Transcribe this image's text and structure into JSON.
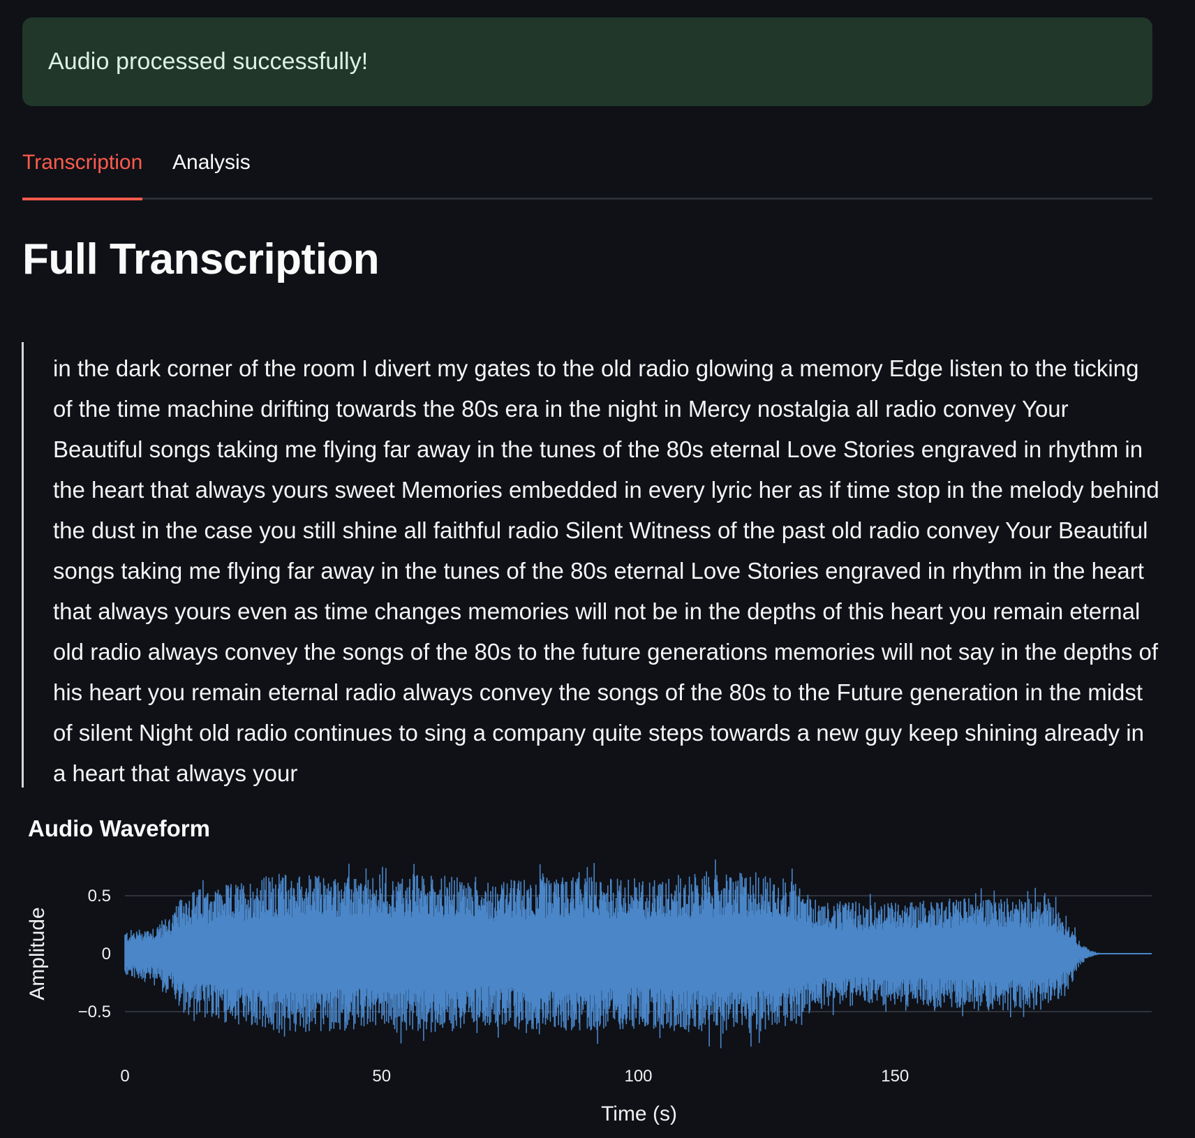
{
  "alert": {
    "message": "Audio processed successfully!",
    "color": "#203729"
  },
  "tabs": [
    {
      "label": "Transcription",
      "active": true
    },
    {
      "label": "Analysis",
      "active": false
    }
  ],
  "accent_color": "#ff5b4c",
  "heading": "Full Transcription",
  "transcription": "in the dark corner of the room I divert my gates to the old radio glowing a memory Edge listen to the ticking of the time machine drifting towards the 80s era in the night in Mercy nostalgia all radio convey Your Beautiful songs taking me flying far away in the tunes of the 80s eternal Love Stories engraved in rhythm in the heart that always yours sweet Memories embedded in every lyric her as if time stop in the melody behind the dust in the case you still shine all faithful radio Silent Witness of the past old radio convey Your Beautiful songs taking me flying far away in the tunes of the 80s eternal Love Stories engraved in rhythm in the heart that always yours even as time changes memories will not be in the depths of this heart you remain eternal old radio always convey the songs of the 80s to the future generations memories will not say in the depths of his heart you remain eternal radio always convey the songs of the 80s to the Future generation in the midst of silent Night old radio continues to sing a company quite steps towards a new guy keep shining already in a heart that always your",
  "waveform_title": "Audio Waveform",
  "chart_data": {
    "type": "area",
    "title": "Audio Waveform",
    "xlabel": "Time (s)",
    "ylabel": "Amplitude",
    "xlim": [
      0,
      200
    ],
    "ylim": [
      -0.85,
      0.85
    ],
    "x_ticks": [
      0,
      50,
      100,
      150
    ],
    "x_tick_labels": [
      "0",
      "50",
      "100",
      "150"
    ],
    "y_ticks": [
      0.5,
      0,
      -0.5
    ],
    "y_tick_labels": [
      "0.5",
      "0",
      "−0.5"
    ],
    "grid": true,
    "line_color": "#4a86c8",
    "series": [
      {
        "envelope_time": [
          0,
          3,
          6,
          9,
          12,
          20,
          30,
          40,
          50,
          60,
          70,
          80,
          90,
          100,
          110,
          120,
          130,
          135,
          140,
          150,
          160,
          170,
          180,
          184,
          186,
          188,
          190,
          200
        ],
        "envelope_peak": [
          0.2,
          0.22,
          0.25,
          0.35,
          0.55,
          0.6,
          0.7,
          0.68,
          0.65,
          0.7,
          0.62,
          0.66,
          0.68,
          0.64,
          0.68,
          0.7,
          0.65,
          0.45,
          0.45,
          0.45,
          0.48,
          0.5,
          0.48,
          0.3,
          0.1,
          0.03,
          0.005,
          0.0
        ]
      }
    ]
  }
}
